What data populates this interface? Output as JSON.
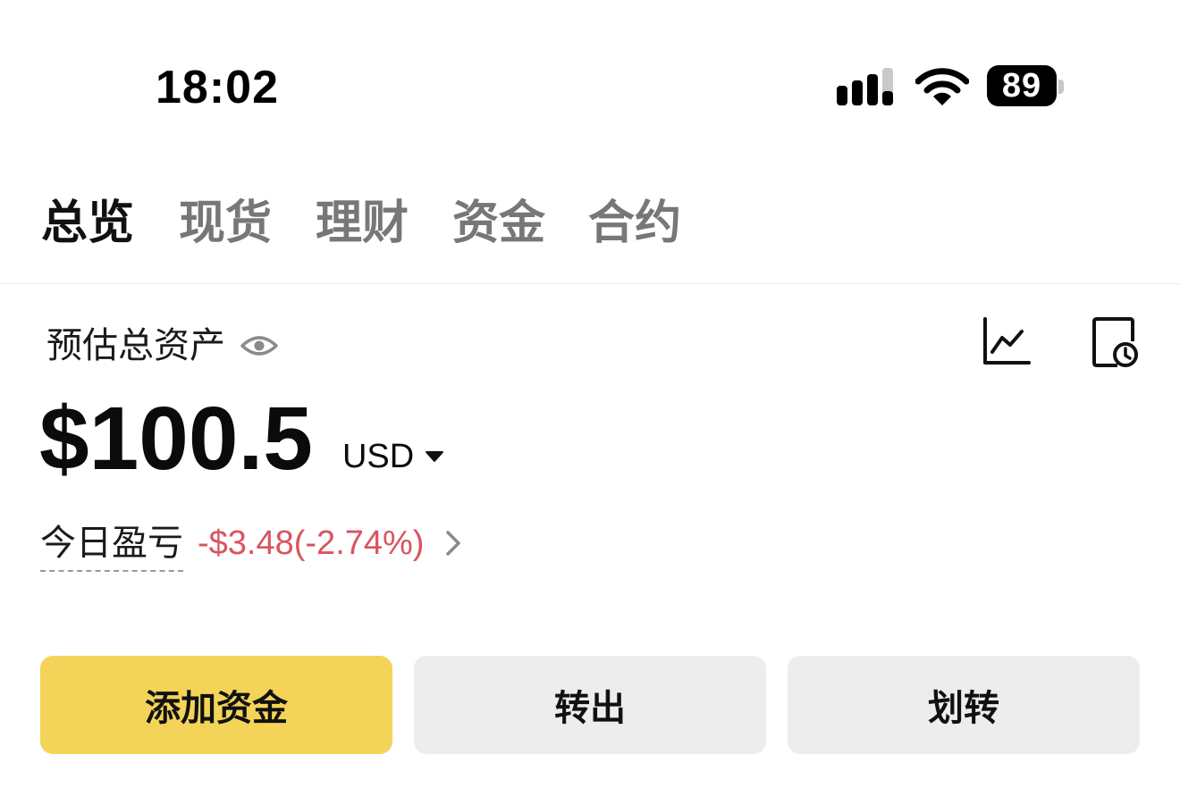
{
  "status_bar": {
    "time": "18:02",
    "battery": "89",
    "icons": [
      "signal-icon",
      "wifi-icon",
      "battery-icon"
    ]
  },
  "tabs": [
    {
      "label": "总览",
      "active": true
    },
    {
      "label": "现货",
      "active": false
    },
    {
      "label": "理财",
      "active": false
    },
    {
      "label": "资金",
      "active": false
    },
    {
      "label": "合约",
      "active": false
    }
  ],
  "asset": {
    "label": "预估总资产",
    "amount": "$100.5",
    "currency": "USD",
    "icons": [
      "eye-icon",
      "chart-icon",
      "history-icon",
      "caret-down-icon"
    ]
  },
  "pnl": {
    "label": "今日盈亏",
    "value": "-$3.48(-2.74%)",
    "color": "#d9545f"
  },
  "actions": {
    "deposit_label": "添加资金",
    "withdraw_label": "转出",
    "transfer_label": "划转",
    "primary_color": "#f4d458",
    "secondary_color": "#ededed"
  }
}
